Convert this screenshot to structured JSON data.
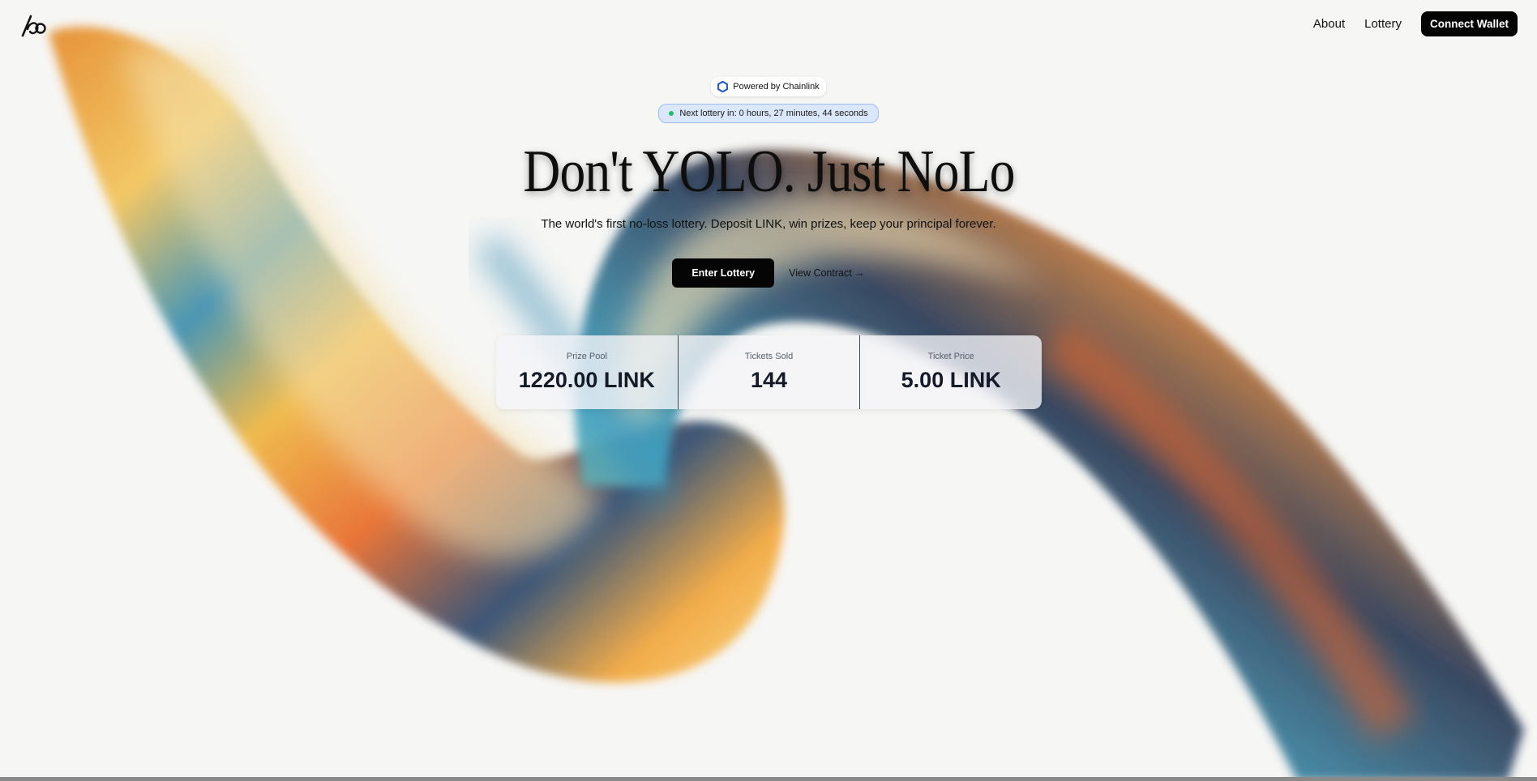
{
  "header": {
    "logo_icon": "nolo-logo-icon",
    "nav": [
      {
        "label": "About"
      },
      {
        "label": "Lottery"
      }
    ],
    "connect_label": "Connect Wallet"
  },
  "badge": {
    "icon": "chainlink-hexagon-icon",
    "label": "Powered by Chainlink",
    "brand_color": "#2a5ada"
  },
  "countdown": {
    "text": "Next lottery in: 0 hours, 27 minutes, 44 seconds",
    "status_color": "#1fc06a"
  },
  "hero": {
    "title": "Don't YOLO. Just NoLo",
    "subtitle": "The world's first no-loss lottery. Deposit LINK, win prizes, keep your principal forever."
  },
  "ctas": {
    "enter_label": "Enter Lottery",
    "contract_label": "View Contract →"
  },
  "stats": [
    {
      "label": "Prize Pool",
      "value": "1220.00 LINK"
    },
    {
      "label": "Tickets Sold",
      "value": "144"
    },
    {
      "label": "Ticket Price",
      "value": "5.00 LINK"
    }
  ]
}
